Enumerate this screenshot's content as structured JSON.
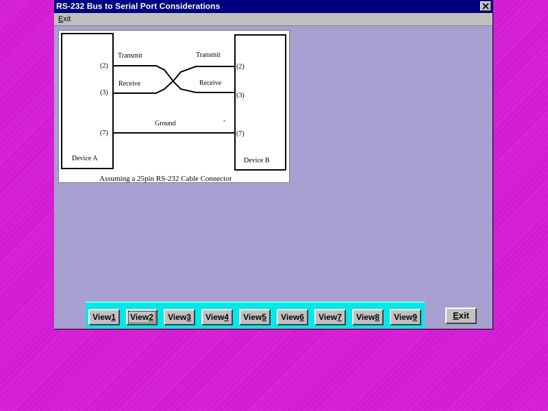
{
  "window": {
    "title": "RS-232 Bus to Serial Port Considerations",
    "menu": [
      {
        "prefix": "E",
        "rest": "xit"
      }
    ]
  },
  "diagram": {
    "device_a": "Device A",
    "device_b": "Device B",
    "pins_a": [
      "(2)",
      "(3)",
      "(7)"
    ],
    "pins_b": [
      "(2)",
      "(3)",
      "(7)"
    ],
    "transmit_a": "Transmit",
    "receive_a": "Receive",
    "transmit_b": "Transmit",
    "receive_b": "Receive",
    "ground": "Ground",
    "dash": "-",
    "caption": "Assuming a 25pin RS-232 Cable Connector"
  },
  "view_buttons": [
    {
      "text": "View",
      "key": "1"
    },
    {
      "text": "View",
      "key": "2",
      "selected": true
    },
    {
      "text": "View",
      "key": "3"
    },
    {
      "text": "View",
      "key": "4"
    },
    {
      "text": "View",
      "key": "5"
    },
    {
      "text": "View",
      "key": "6"
    },
    {
      "text": "View",
      "key": "7"
    },
    {
      "text": "View",
      "key": "8"
    },
    {
      "text": "View",
      "key": "9"
    }
  ],
  "exit_button": {
    "prefix": "E",
    "rest": "xit"
  },
  "colors": {
    "desktop": "#d800d8",
    "titlebar": "#000080",
    "button_bar": "#00e8e8",
    "window_body": "#a8a0d0"
  }
}
